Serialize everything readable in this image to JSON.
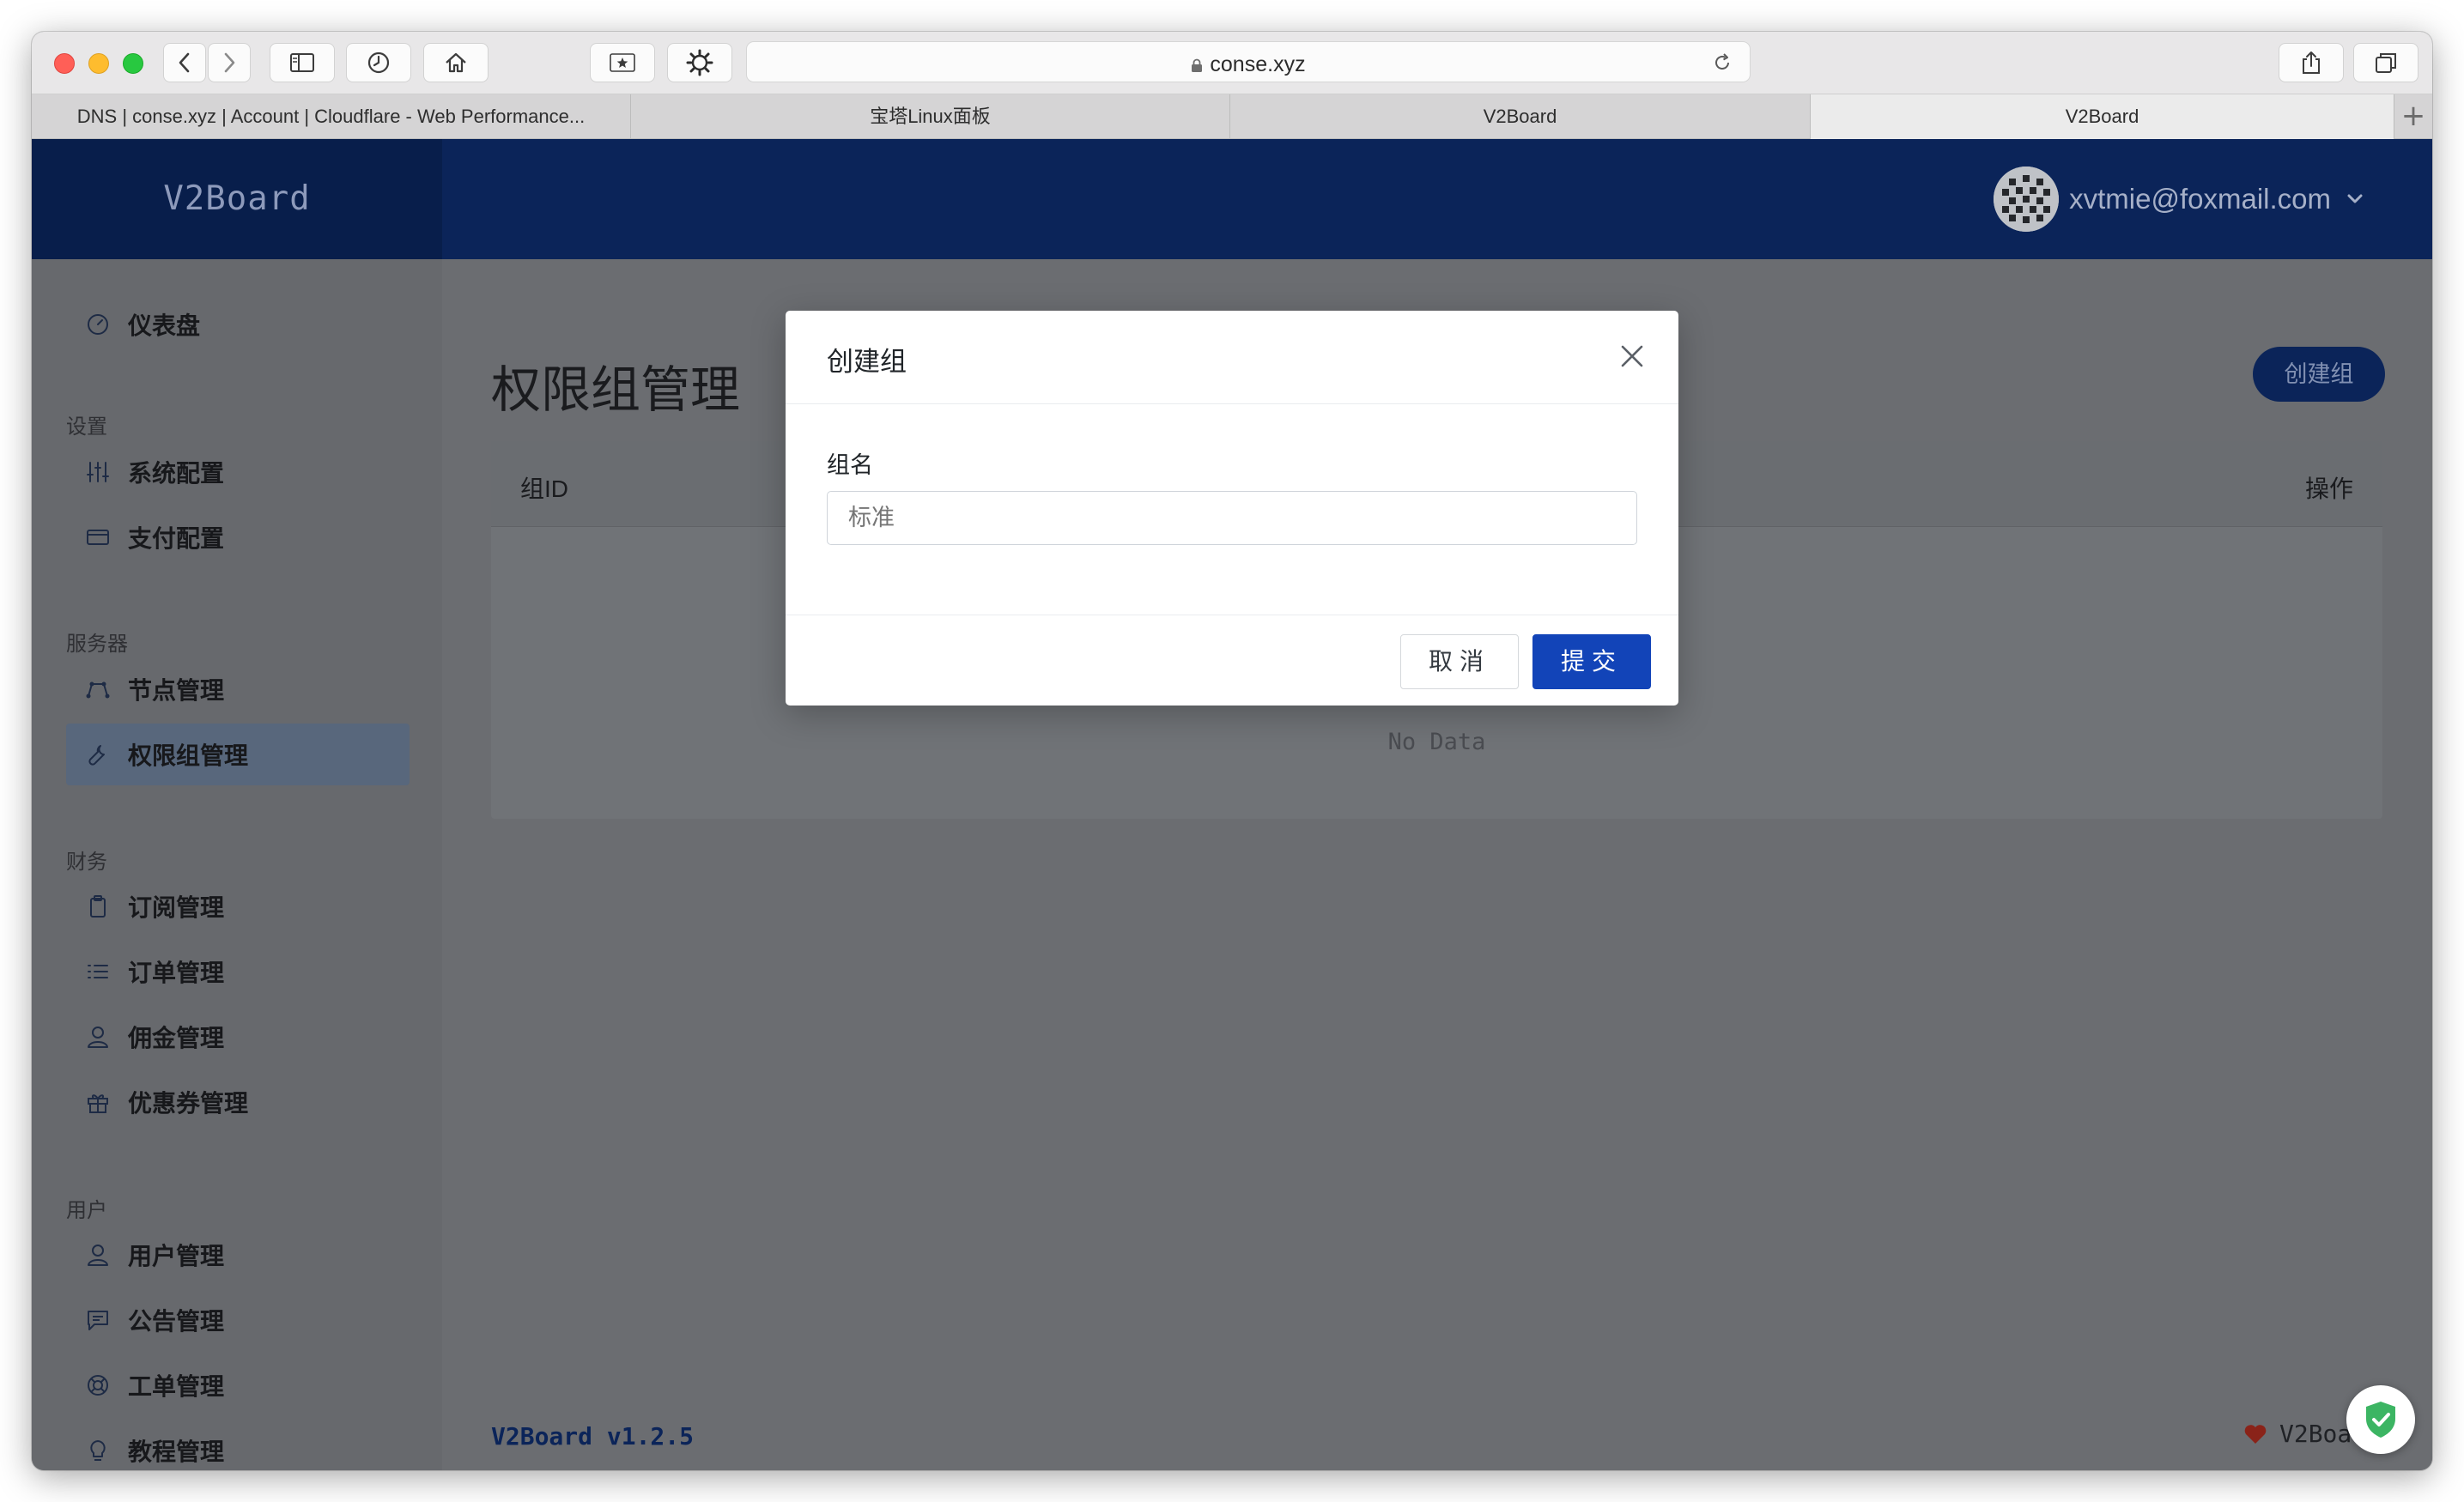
{
  "browser": {
    "url": "conse.xyz",
    "tabs": [
      {
        "label": "DNS | conse.xyz | Account | Cloudflare - Web Performance..."
      },
      {
        "label": "宝塔Linux面板"
      },
      {
        "label": "V2Board"
      },
      {
        "label": "V2Board"
      }
    ],
    "active_tab_index": 3
  },
  "header": {
    "brand": "V2Board",
    "user_email": "xvtmie@foxmail.com"
  },
  "sidebar": {
    "dashboard": "仪表盘",
    "sections": [
      {
        "title": "设置",
        "items": [
          {
            "label": "系统配置",
            "icon": "sliders-icon"
          },
          {
            "label": "支付配置",
            "icon": "credit-card-icon"
          }
        ]
      },
      {
        "title": "服务器",
        "items": [
          {
            "label": "节点管理",
            "icon": "node-icon"
          },
          {
            "label": "权限组管理",
            "icon": "wrench-icon",
            "active": true
          }
        ]
      },
      {
        "title": "财务",
        "items": [
          {
            "label": "订阅管理",
            "icon": "clipboard-icon"
          },
          {
            "label": "订单管理",
            "icon": "list-icon"
          },
          {
            "label": "佣金管理",
            "icon": "user-icon"
          },
          {
            "label": "优惠券管理",
            "icon": "gift-icon"
          }
        ]
      },
      {
        "title": "用户",
        "items": [
          {
            "label": "用户管理",
            "icon": "user-icon"
          },
          {
            "label": "公告管理",
            "icon": "message-icon"
          },
          {
            "label": "工单管理",
            "icon": "support-icon"
          },
          {
            "label": "教程管理",
            "icon": "bulb-icon"
          }
        ]
      }
    ]
  },
  "main": {
    "page_title": "权限组管理",
    "create_button": "创建组",
    "table": {
      "columns": [
        "组ID",
        "操作"
      ],
      "empty_text": "No Data"
    },
    "footer_version": "V2Board v1.2.5",
    "footer_right": "V2Board"
  },
  "modal": {
    "title": "创建组",
    "field_label": "组名",
    "field_placeholder": "标准",
    "field_value": "",
    "cancel_label": "取消",
    "submit_label": "提交"
  },
  "colors": {
    "header_bg": "#0b2459",
    "primary_button": "#1244b8",
    "overlay": "#6b6d71"
  }
}
